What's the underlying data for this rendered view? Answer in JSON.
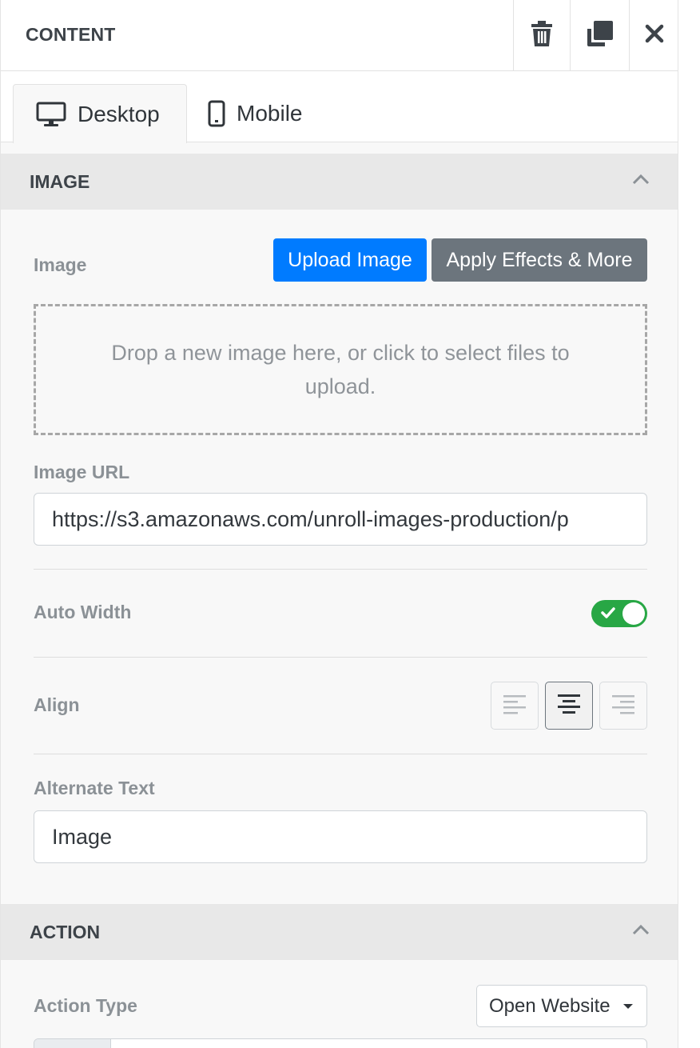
{
  "header": {
    "title": "CONTENT",
    "icons": [
      "trash-icon",
      "duplicate-icon",
      "close-icon"
    ]
  },
  "tabs": [
    {
      "label": "Desktop",
      "icon": "desktop-icon",
      "active": true
    },
    {
      "label": "Mobile",
      "icon": "mobile-icon",
      "active": false
    }
  ],
  "image_section": {
    "title": "IMAGE",
    "image_label": "Image",
    "upload_button": "Upload Image",
    "effects_button": "Apply Effects & More",
    "dropzone_text": "Drop a new image here, or click to select files to upload.",
    "url_label": "Image URL",
    "url_value": "https://s3.amazonaws.com/unroll-images-production/p",
    "auto_width_label": "Auto Width",
    "auto_width_on": true,
    "align_label": "Align",
    "align_options": [
      "left",
      "center",
      "right"
    ],
    "align_selected": "center",
    "alt_label": "Alternate Text",
    "alt_value": "Image"
  },
  "action_section": {
    "title": "ACTION",
    "action_type_label": "Action Type",
    "action_type_value": "Open Website"
  },
  "colors": {
    "primary": "#007bff",
    "secondary": "#6c757d",
    "toggle_on": "#28a745"
  }
}
